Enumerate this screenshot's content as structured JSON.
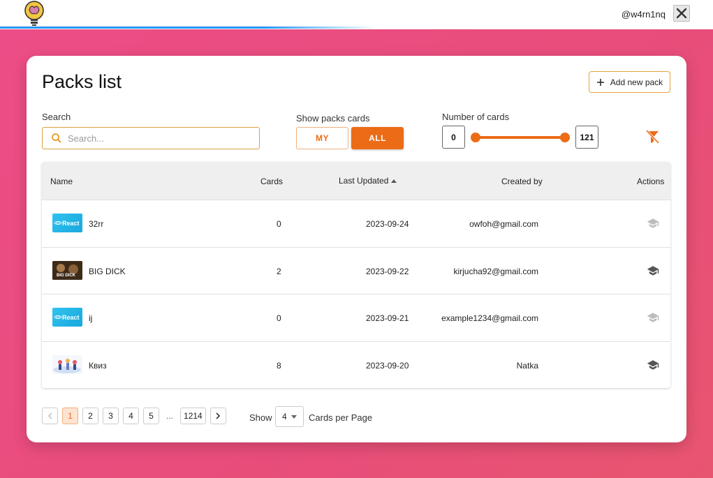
{
  "header": {
    "username": "@w4rn1nq"
  },
  "page": {
    "title": "Packs list",
    "add_button_label": "Add new pack"
  },
  "filters": {
    "search_label": "Search",
    "search_placeholder": "Search...",
    "show_label": "Show packs cards",
    "my_label": "MY",
    "all_label": "ALL",
    "selected": "ALL",
    "number_label": "Number of cards",
    "min_value": "0",
    "max_value": "121"
  },
  "table": {
    "columns": {
      "name": "Name",
      "cards": "Cards",
      "last_updated": "Last Updated",
      "created_by": "Created by",
      "actions": "Actions"
    },
    "sort": {
      "column": "Last Updated",
      "direction": "asc"
    },
    "rows": [
      {
        "name": "32rr",
        "cards": "0",
        "updated": "2023-09-24",
        "created_by": "owfoh@gmail.com",
        "thumb_text": "React",
        "learn_enabled": false
      },
      {
        "name": "BIG DICK",
        "cards": "2",
        "updated": "2023-09-22",
        "created_by": "kirjucha92@gmail.com",
        "thumb_text": "BIG DICK",
        "learn_enabled": true
      },
      {
        "name": "ij",
        "cards": "0",
        "updated": "2023-09-21",
        "created_by": "example1234@gmail.com",
        "thumb_text": "React",
        "learn_enabled": false
      },
      {
        "name": "Квиз",
        "cards": "8",
        "updated": "2023-09-20",
        "created_by": "Natka",
        "thumb_text": "",
        "learn_enabled": true
      }
    ]
  },
  "pagination": {
    "pages": [
      "1",
      "2",
      "3",
      "4",
      "5"
    ],
    "ellipsis": "...",
    "last_page": "1214",
    "current": "1",
    "show_label": "Show",
    "per_page": "4",
    "per_page_suffix": "Cards per Page"
  },
  "colors": {
    "accent": "#ec6b16",
    "background": "#ea4e7e",
    "topbar_line": "#2196f3"
  }
}
